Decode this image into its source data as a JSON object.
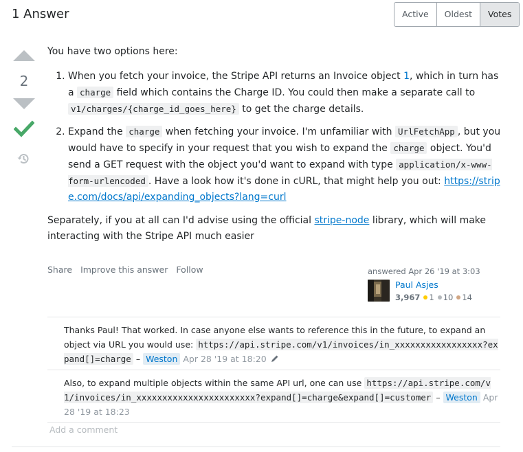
{
  "header": {
    "title": "1 Answer",
    "sort_tabs": [
      {
        "label": "Active"
      },
      {
        "label": "Oldest"
      },
      {
        "label": "Votes"
      }
    ]
  },
  "votes": {
    "count": "2"
  },
  "answer": {
    "intro": "You have two options here:",
    "item1": {
      "t1": "When you fetch your invoice, the Stripe API returns an Invoice object ",
      "link": "1",
      "t2": ", which in turn has a ",
      "code1": "charge",
      "t3": " field which contains the Charge ID. You could then make a separate call to ",
      "code2": "v1/charges/{charge_id_goes_here}",
      "t4": " to get the charge details."
    },
    "item2": {
      "t1": "Expand the ",
      "code1": "charge",
      "t2": " when fetching your invoice. I'm unfamiliar with ",
      "code2": "UrlFetchApp",
      "t3": ", but you would have to specify in your request that you wish to expand the ",
      "code3": "charge",
      "t4": " object. You'd send a GET request with the object you'd want to expand with type ",
      "code4": "application/x-www-form-urlencoded",
      "t5": ". Have a look how it's done in cURL, that might help you out: ",
      "link": "https://stripe.com/docs/api/expanding_objects?lang=curl"
    },
    "closing": {
      "t1": "Separately, if you at all can I'd advise using the official ",
      "link": "stripe-node",
      "t2": " library, which will make interacting with the Stripe API much easier"
    }
  },
  "post_menu": {
    "share": "Share",
    "improve": "Improve this answer",
    "follow": "Follow"
  },
  "signature": {
    "action": "answered Apr 26 '19 at 3:03",
    "user_name": "Paul Asjes",
    "reputation": "3,967",
    "gold": "1",
    "silver": "10",
    "bronze": "14"
  },
  "comments": [
    {
      "text": "Thanks Paul! That worked. In case anyone else wants to reference this in the future, to expand an object via URL you would use: ",
      "code": "https://api.stripe.com/v1/invoices/in_xxxxxxxxxxxxxxxxx?expand[]=charge",
      "dash": "–",
      "user": "Weston",
      "date": "Apr 28 '19 at 18:20"
    },
    {
      "text": "Also, to expand multiple objects within the same API url, one can use ",
      "code": "https://api.stripe.com/v1/invoices/in_xxxxxxxxxxxxxxxxxxxxxxx?expand[]=charge&expand[]=customer",
      "dash": "–",
      "user": "Weston",
      "date": "Apr 28 '19 at 18:23"
    }
  ],
  "add_comment": "Add a comment",
  "colors": {
    "accepted": "#48a868",
    "link": "#0077cc",
    "gold": "#ffcc01",
    "silver": "#b4b8bc",
    "bronze": "#d1a684"
  }
}
